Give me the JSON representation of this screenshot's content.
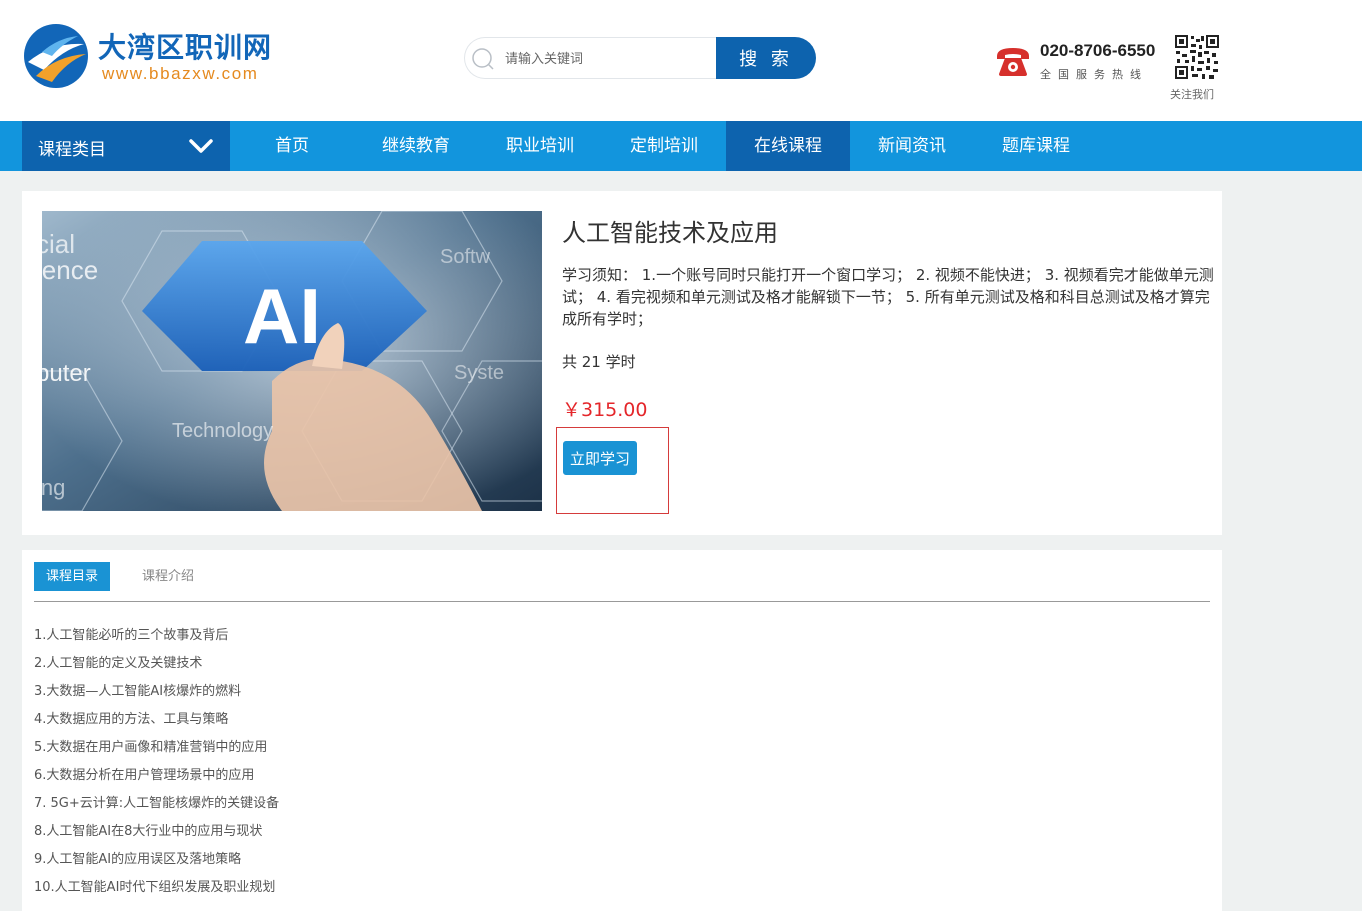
{
  "header": {
    "logo_title": "大湾区职训网",
    "logo_url": "www.bbazxw.com",
    "search_placeholder": "请输入关键词",
    "search_button": "搜 索",
    "hotline_number": "020-8706-6550",
    "hotline_label": "全国服务热线",
    "qr_label": "关注我们"
  },
  "nav": {
    "category_label": "课程类目",
    "items": [
      {
        "label": "首页",
        "active": false
      },
      {
        "label": "继续教育",
        "active": false
      },
      {
        "label": "职业培训",
        "active": false
      },
      {
        "label": "定制培训",
        "active": false
      },
      {
        "label": "在线课程",
        "active": true
      },
      {
        "label": "新闻资讯",
        "active": false
      },
      {
        "label": "题库课程",
        "active": false
      }
    ]
  },
  "course": {
    "title": "人工智能技术及应用",
    "image_words": {
      "ai": "AI",
      "w1": "cial",
      "w2": "ience",
      "w3": "puter",
      "w4": "ing",
      "w5": "Softw",
      "w6": "Syste",
      "w7": "Technology"
    },
    "notice": "学习须知： 1.一个账号同时只能打开一个窗口学习； 2. 视频不能快进； 3. 视频看完才能做单元测试； 4. 看完视频和单元测试及格才能解锁下一节； 5. 所有单元测试及格和科目总测试及格才算完成所有学时；",
    "hours": "共 21 学时",
    "price": "￥315.00",
    "study_button": "立即学习"
  },
  "tabs": {
    "catalog": "课程目录",
    "intro": "课程介绍"
  },
  "lessons": [
    "1.人工智能必听的三个故事及背后",
    "2.人工智能的定义及关键技术",
    "3.大数据—人工智能AI核爆炸的燃料",
    "4.大数据应用的方法、工具与策略",
    "5.大数据在用户画像和精准营销中的应用",
    "6.大数据分析在用户管理场景中的应用",
    "7. 5G+云计算:人工智能核爆炸的关键设备",
    "8.人工智能AI在8大行业中的应用与现状",
    "9.人工智能AI的应用误区及落地策略",
    "10.人工智能AI时代下组织发展及职业规划"
  ],
  "colors": {
    "brand_blue": "#0d63ae",
    "nav_blue": "#1295dd",
    "button_blue": "#1a93d4",
    "price_red": "#e4262a",
    "logo_orange": "#e58a1f"
  }
}
